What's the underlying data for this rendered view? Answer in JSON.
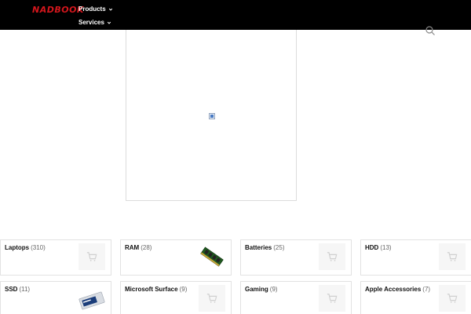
{
  "header": {
    "logo": "NADBOOK",
    "nav": [
      {
        "label": "Products"
      },
      {
        "label": "Services"
      }
    ]
  },
  "categories": [
    {
      "name": "Laptops",
      "count": "(310)",
      "thumb": "cart-icon"
    },
    {
      "name": "RAM",
      "count": "(28)",
      "thumb": "ram-module-image"
    },
    {
      "name": "Batteries",
      "count": "(25)",
      "thumb": "cart-icon"
    },
    {
      "name": "HDD",
      "count": "(13)",
      "thumb": "cart-icon"
    },
    {
      "name": "SSD",
      "count": "(11)",
      "thumb": "ssd-drive-image"
    },
    {
      "name": "Microsoft Surface",
      "count": "(9)",
      "thumb": "cart-icon"
    },
    {
      "name": "Gaming",
      "count": "(9)",
      "thumb": "cart-icon"
    },
    {
      "name": "Apple Accessories",
      "count": "(7)",
      "thumb": "cart-icon"
    }
  ],
  "colors": {
    "header_bg": "#000000",
    "logo": "#d4161c",
    "thumb_bg": "#f6f6f6",
    "cart_icon": "#d0d0d0"
  }
}
